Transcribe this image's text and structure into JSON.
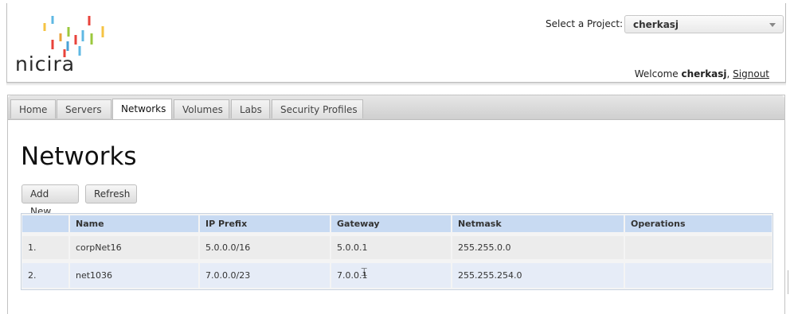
{
  "header": {
    "logo_text": "nicira",
    "project_label": "Select a Project:",
    "project_value": "cherkasj",
    "welcome_prefix": "Welcome",
    "welcome_user": "cherkasj",
    "signout_label": "Signout"
  },
  "tabs": [
    {
      "label": "Home"
    },
    {
      "label": "Servers"
    },
    {
      "label": "Networks",
      "active": true
    },
    {
      "label": "Volumes"
    },
    {
      "label": "Labs"
    },
    {
      "label": "Security Profiles"
    }
  ],
  "page": {
    "title": "Networks",
    "add_new_label": "Add New",
    "refresh_label": "Refresh"
  },
  "table": {
    "columns": [
      "",
      "Name",
      "IP Prefix",
      "Gateway",
      "Netmask",
      "Operations"
    ],
    "rows": [
      {
        "num": "1.",
        "name": "corpNet16",
        "ip_prefix": "5.0.0.0/16",
        "gateway": "5.0.0.1",
        "netmask": "255.255.0.0",
        "operations": ""
      },
      {
        "num": "2.",
        "name": "net1036",
        "ip_prefix": "7.0.0.0/23",
        "gateway": "7.0.0.1",
        "netmask": "255.255.254.0",
        "operations": ""
      }
    ]
  },
  "colors": {
    "table_header": "#c8daf2",
    "row_alt": "#e6ecf7",
    "logo_colors": [
      "#f5c343",
      "#e8433b",
      "#5fb8e3",
      "#9bc83d",
      "#e8a23a",
      "#4aa2d6"
    ]
  }
}
